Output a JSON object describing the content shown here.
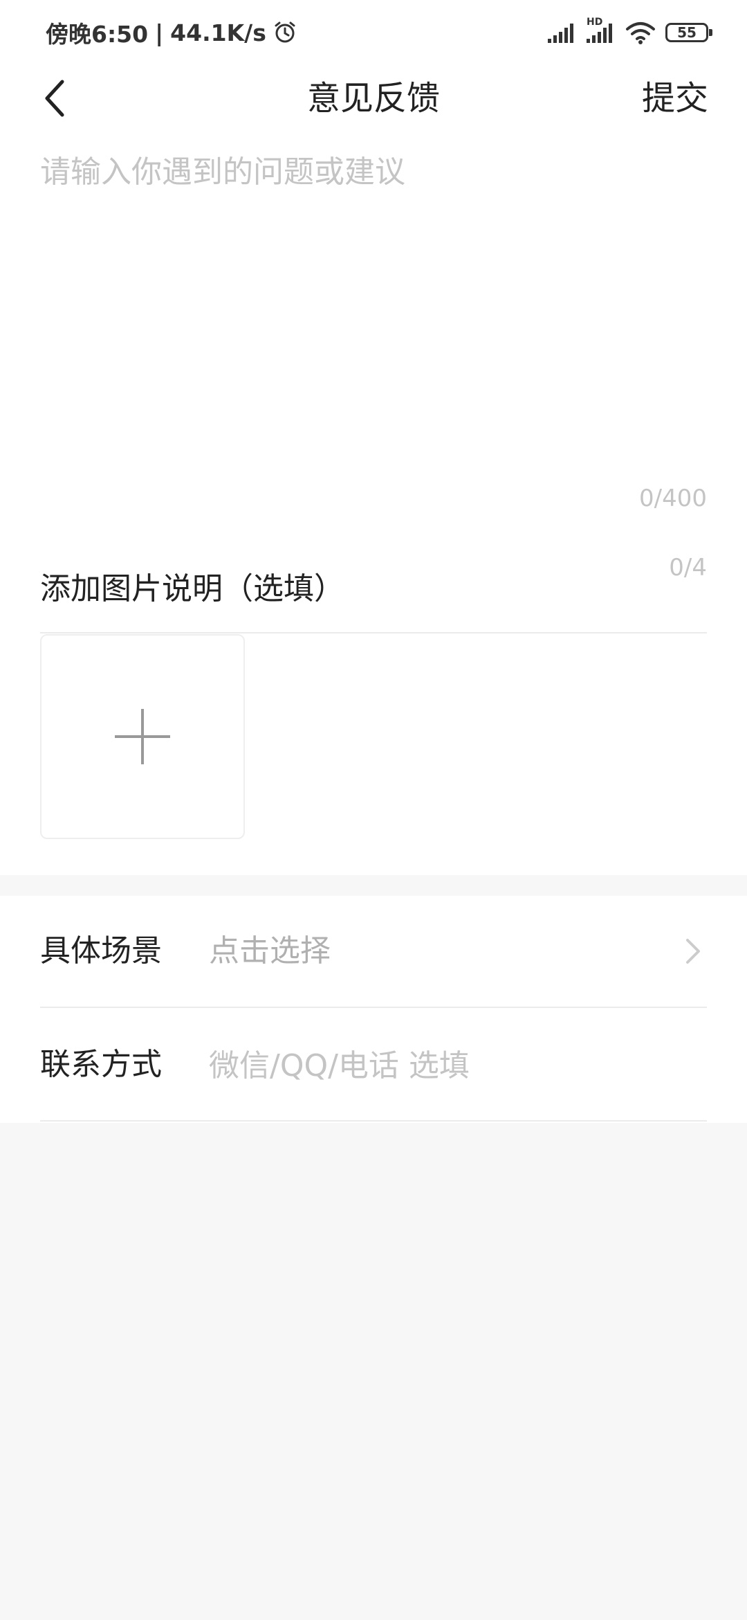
{
  "status_bar": {
    "time_label": "傍晚6:50",
    "separator": "|",
    "network_speed": "44.1K/s",
    "battery": "55",
    "hd_label": "HD",
    "alarm_icon": "alarm-icon",
    "signal_icon": "signal-icon",
    "wifi_icon": "wifi-icon"
  },
  "header": {
    "title": "意见反馈",
    "submit_label": "提交",
    "back_icon": "back-arrow-icon"
  },
  "feedback": {
    "placeholder": "请输入你遇到的问题或建议",
    "value": "",
    "char_count": "0/400"
  },
  "images": {
    "title": "添加图片说明（选填）",
    "count": "0/4",
    "add_icon": "plus-icon"
  },
  "form": {
    "scene_label": "具体场景",
    "scene_value": "点击选择",
    "contact_label": "联系方式",
    "contact_placeholder": "微信/QQ/电话 选填",
    "chevron_icon": "chevron-right-icon"
  },
  "colors": {
    "background": "#f7f7f7",
    "surface": "#ffffff",
    "text_primary": "#222222",
    "text_placeholder": "#c4c4c4",
    "divider": "#ebebeb"
  }
}
